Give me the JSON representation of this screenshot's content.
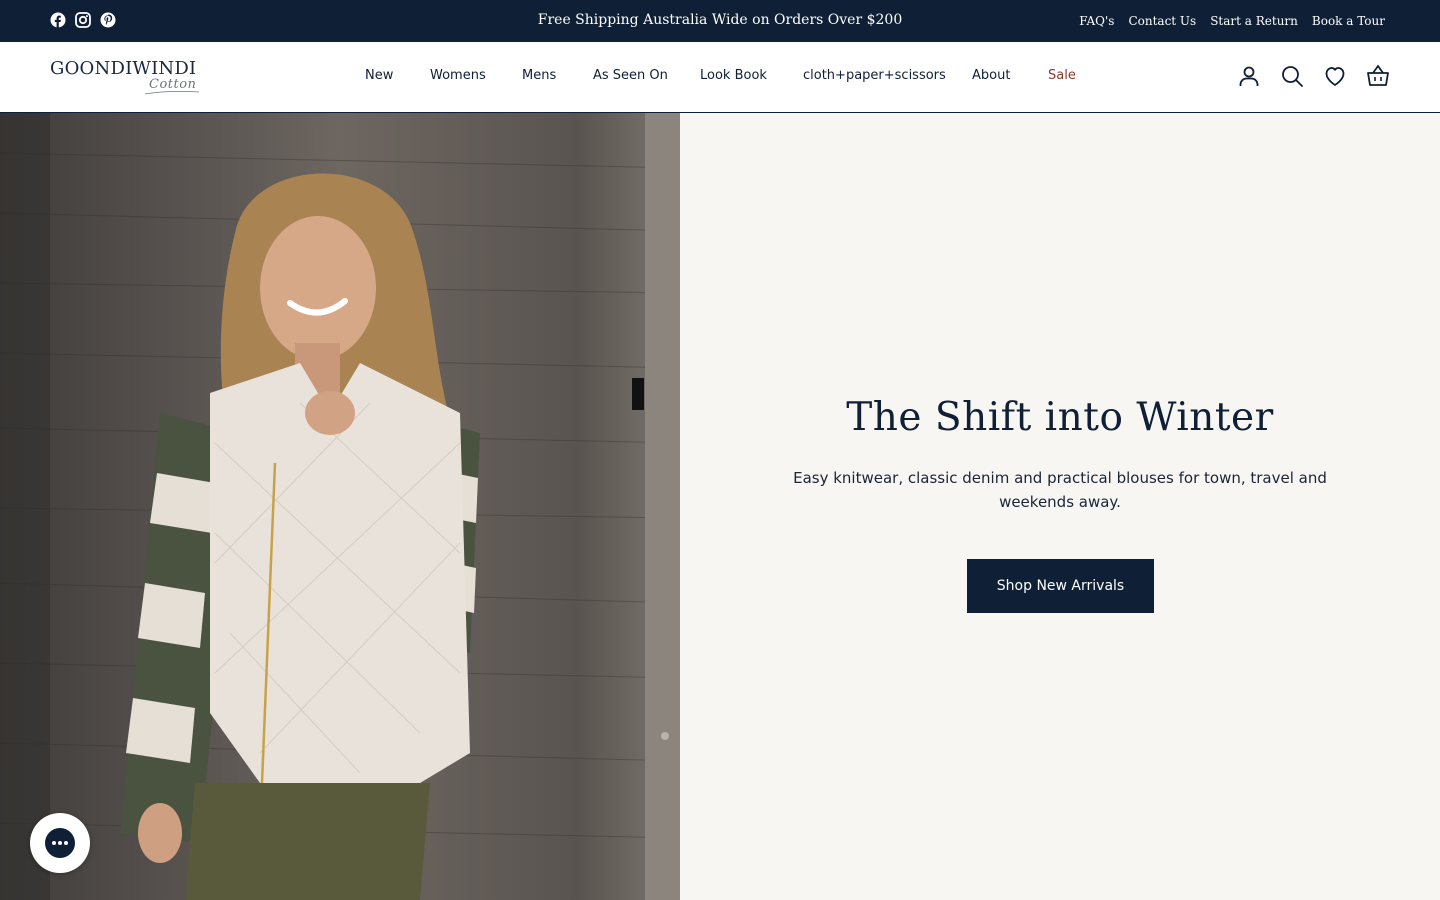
{
  "announcement": {
    "text": "Free Shipping Australia Wide on Orders Over $200",
    "socials": [
      "facebook-icon",
      "instagram-icon",
      "pinterest-icon"
    ],
    "links": [
      "FAQ's",
      "Contact Us",
      "Start a Return",
      "Book a Tour"
    ]
  },
  "header": {
    "logo": {
      "word": "GOONDIWINDI",
      "script": "Cotton"
    },
    "nav": [
      "New",
      "Womens",
      "Mens",
      "As Seen On",
      "Look Book",
      "cloth+paper+scissors",
      "About",
      "Sale"
    ],
    "icons": [
      "account-icon",
      "search-icon",
      "wishlist-heart-icon",
      "basket-icon"
    ]
  },
  "hero": {
    "title": "The Shift into Winter",
    "text": "Easy knitwear, classic denim and practical blouses for town, travel and weekends away.",
    "button": "Shop New Arrivals",
    "image_subject": "woman in quilted cream vest and olive striped jumper leaning on weathered timber wall"
  },
  "colors": {
    "navy": "#0f1f36",
    "panel_bg": "#f7f6f3",
    "sale": "#8a3a2b"
  }
}
